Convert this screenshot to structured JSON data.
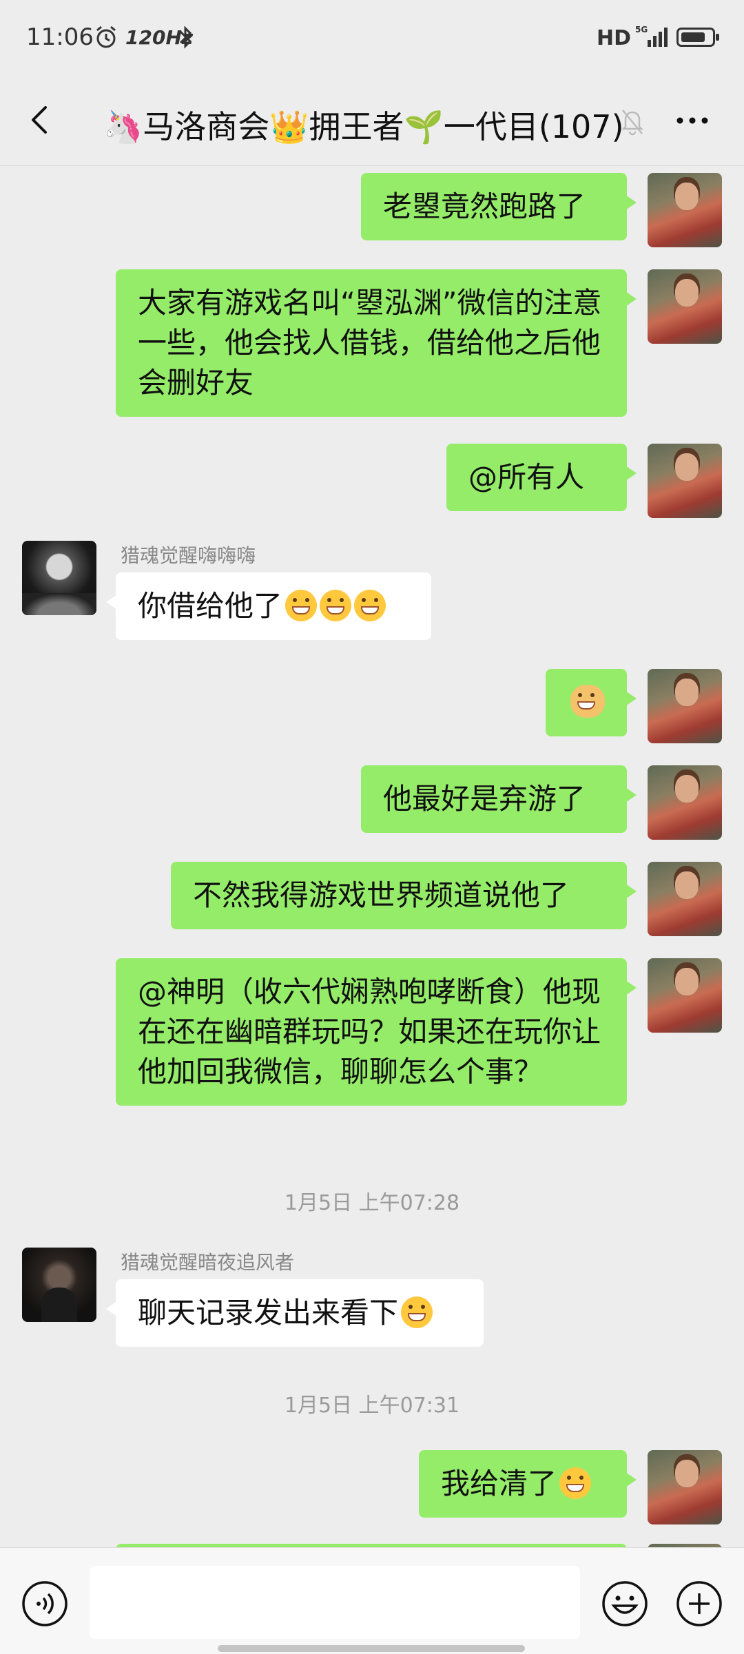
{
  "status": {
    "time": "11:06",
    "refresh": "120Hz",
    "hd": "HD",
    "network": "5G",
    "battery_level": 0.8
  },
  "header": {
    "title": "🦄马洛商会👑拥王者🌱一代目(107)"
  },
  "messages": [
    {
      "side": "me",
      "text": "老曌竟然跑路了"
    },
    {
      "side": "me",
      "text": "大家有游戏名叫“曌泓渊”微信的注意一些，他会找人借钱，借给他之后他会删好友"
    },
    {
      "side": "me",
      "text": "@所有人"
    },
    {
      "side": "other",
      "sender": "猎魂觉醒嗨嗨嗨",
      "text": "你借给他了",
      "emoji": "grin-icon ×3"
    },
    {
      "side": "me",
      "emoji": "doge-icon"
    },
    {
      "side": "me",
      "text": "他最好是弃游了"
    },
    {
      "side": "me",
      "text": "不然我得游戏世界频道说他了"
    },
    {
      "side": "me",
      "text": "@神明（收六代娴熟咆哮断食）他现在还在幽暗群玩吗？如果还在玩你让他加回我微信，聊聊怎么个事？"
    },
    {
      "side": "other",
      "sender": "猎魂觉醒暗夜追风者",
      "text": "聊天记录发出来看下",
      "emoji": "grin-icon"
    },
    {
      "side": "me",
      "text": "我给清了",
      "emoji": "tears-of-joy-icon"
    }
  ],
  "timestamps": [
    "1月5日 上午07:28",
    "1月5日 上午07:31"
  ],
  "colors": {
    "background": "#ededed",
    "my_bubble": "#95ec69",
    "other_bubble": "#ffffff",
    "timestamp_text": "#9a9a9a"
  },
  "input": {
    "value": ""
  }
}
